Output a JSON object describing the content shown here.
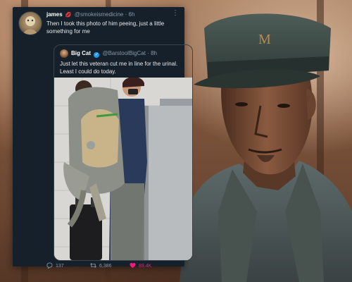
{
  "tweet": {
    "author_name": "james",
    "author_emoji": "💋",
    "author_handle": "@smokeismedicine",
    "time": "6h",
    "more_icon": "more-vertical-icon",
    "text": "Then I took this photo of him peeing, just a little something for me",
    "quoted": {
      "author_name": "Big Cat",
      "verified": true,
      "author_handle": "@BarstoolBigCat",
      "time": "8h",
      "text": "Just let this veteran cut me in line for the urinal. Least I could do today."
    },
    "actions": {
      "replies": "137",
      "retweets": "6,386",
      "likes": "89.4K"
    }
  },
  "colors": {
    "card_bg": "#15202b",
    "text": "#e7e9ea",
    "muted": "#8899a6",
    "like": "#f91880",
    "verified": "#1d9bf0"
  }
}
